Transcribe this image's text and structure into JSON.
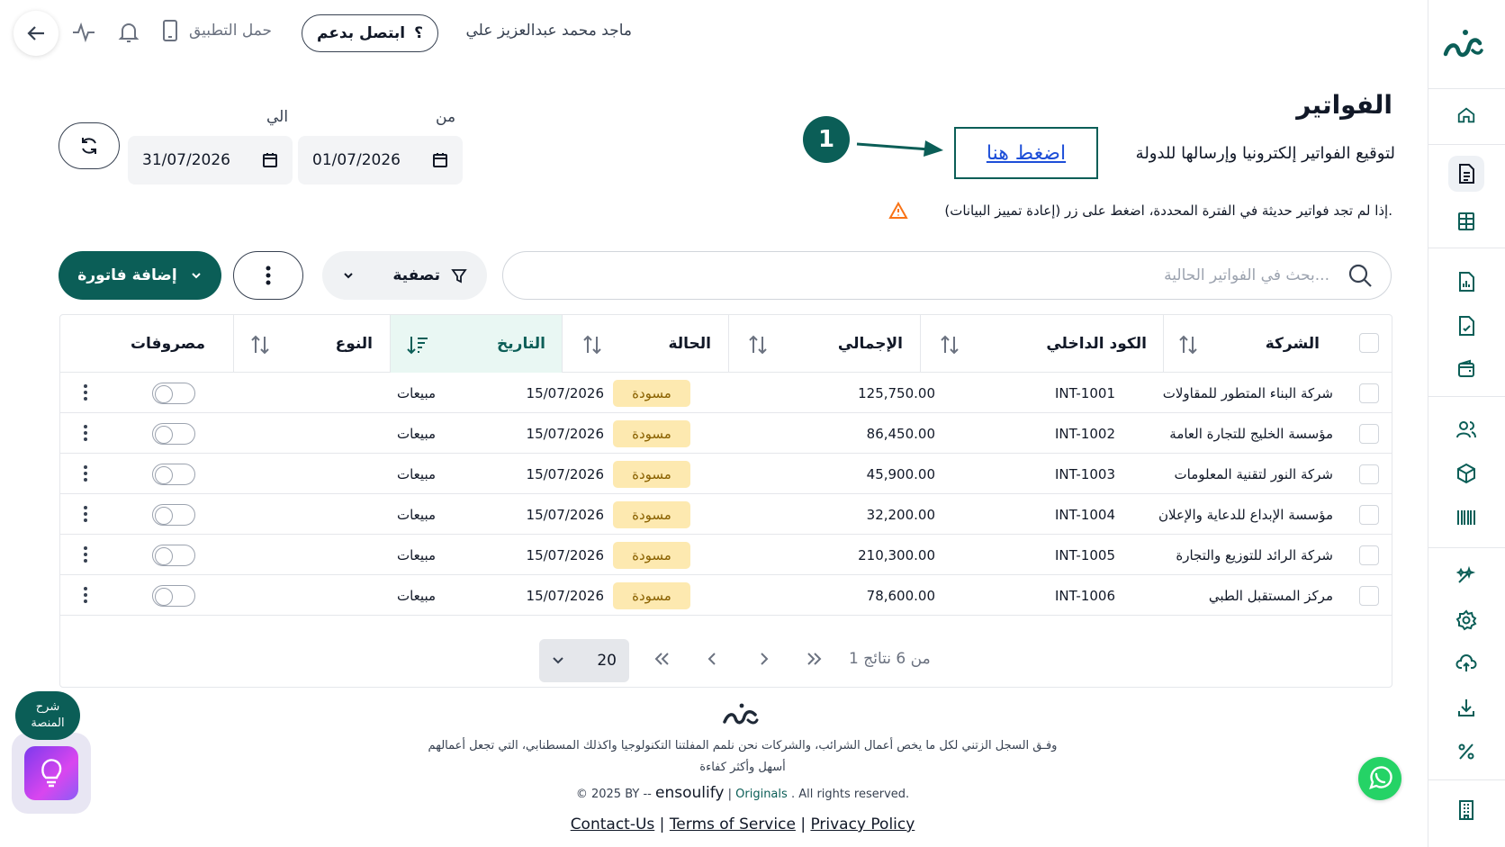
{
  "header": {
    "user_name": "ماجد محمد عبدالعزيز علي",
    "support_label": "ابتصل بدعم",
    "support_icon": "question-mark",
    "app_download_label": "حمل التطبيق"
  },
  "page": {
    "title": "الفواتير",
    "sign_text": "لتوقيع الفواتير إلكترونيا وإرسالها للدولة",
    "click_here": "اضغط هنا",
    "step_number": "1",
    "warning_text": "إذا لم تجد فواتير حديثة في الفترة المحددة، اضغط على زر (إعادة تمييز البيانات)."
  },
  "date_range": {
    "from_label": "من",
    "from_value": "01/07/2026",
    "to_label": "الي",
    "to_value": "31/07/2026"
  },
  "toolbar": {
    "search_placeholder": "بحث في الفواتير الحالية...",
    "filter_label": "تصفية",
    "add_label": "إضافة فاتورة"
  },
  "table": {
    "columns": {
      "company": "الشركة",
      "internal_code": "الكود الداخلي",
      "total": "الإجمالي",
      "status": "الحالة",
      "date": "التاريخ",
      "type": "النوع",
      "expenses": "مصروفات"
    },
    "rows": [
      {
        "company": "شركة البناء المتطور للمقاولات",
        "code": "INT-1001",
        "total": "125,750.00",
        "status": "مسودة",
        "date": "15/07/2026",
        "type": "مبيعات"
      },
      {
        "company": "مؤسسة الخليج للتجارة العامة",
        "code": "INT-1002",
        "total": "86,450.00",
        "status": "مسودة",
        "date": "15/07/2026",
        "type": "مبيعات"
      },
      {
        "company": "شركة النور لتقنية المعلومات",
        "code": "INT-1003",
        "total": "45,900.00",
        "status": "مسودة",
        "date": "15/07/2026",
        "type": "مبيعات"
      },
      {
        "company": "مؤسسة الإبداع للدعاية والإعلان",
        "code": "INT-1004",
        "total": "32,200.00",
        "status": "مسودة",
        "date": "15/07/2026",
        "type": "مبيعات"
      },
      {
        "company": "شركة الرائد للتوزيع والتجارة",
        "code": "INT-1005",
        "total": "210,300.00",
        "status": "مسودة",
        "date": "15/07/2026",
        "type": "مبيعات"
      },
      {
        "company": "مركز المستقبل الطبي",
        "code": "INT-1006",
        "total": "78,600.00",
        "status": "مسودة",
        "date": "15/07/2026",
        "type": "مبيعات"
      }
    ]
  },
  "pagination": {
    "page_size": "20",
    "info": "1 من 6 نتائج"
  },
  "footer": {
    "description_line1": "وفـق السجل الزتني لكل ما يخص أعمال الشرائب، والشركات نحن نلمم المفلتنا التكنولوجيا واكذلك المسطنابي، التي تجعل أعمالهم",
    "description_line2": "أسهل وأكثر كفاءة",
    "copyright_prefix": "© 2025 BY --",
    "brand": "ensoulify",
    "separator": "|",
    "originals": "Originals",
    "rights": ". All rights reserved.",
    "contact": "Contact-Us",
    "terms": "Terms of Service",
    "privacy": "Privacy Policy"
  },
  "floating": {
    "tour_label_line1": "شرح",
    "tour_label_line2": "المنصة"
  },
  "colors": {
    "brand_green": "#0b5e57",
    "draft_badge_bg": "#fde9b0",
    "active_sort_bg": "#e9f7f3",
    "link_blue": "#1d4ed8",
    "whatsapp": "#25d366"
  },
  "icons": {
    "sidebar": [
      "home-icon",
      "invoice-icon",
      "tax-table-icon",
      "report-icon",
      "signed-doc-icon",
      "wallet-icon",
      "users-icon",
      "box-icon",
      "barcode-icon",
      "settings-sparkle-icon",
      "gear-icon",
      "cloud-upload-icon",
      "download-icon",
      "percent-icon",
      "building-icon"
    ]
  }
}
